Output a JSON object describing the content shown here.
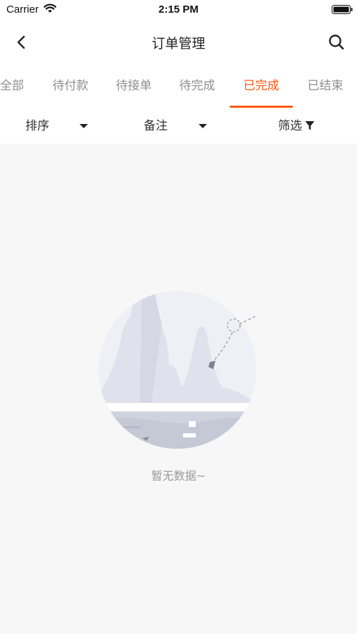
{
  "status_bar": {
    "carrier": "Carrier",
    "time": "2:15 PM",
    "icons": [
      "wifi-icon",
      "battery-icon"
    ]
  },
  "nav": {
    "title": "订单管理",
    "icons": [
      "chevron-left-icon",
      "search-icon"
    ]
  },
  "tabs": {
    "items": [
      {
        "label": "全部"
      },
      {
        "label": "待付款"
      },
      {
        "label": "待接单"
      },
      {
        "label": "待完成"
      },
      {
        "label": "已完成"
      },
      {
        "label": "已结束"
      }
    ],
    "active_index": 4
  },
  "filters": {
    "sort_label": "排序",
    "remark_label": "备注",
    "filter_label": "筛选",
    "icons": [
      "caret-down-icon",
      "funnel-icon"
    ]
  },
  "empty_state": {
    "text": "暂无数据~"
  },
  "colors": {
    "accent": "#ff5a14",
    "tab_inactive": "#8e8e8e",
    "background": "#f7f7f7",
    "empty_text": "#999999"
  }
}
